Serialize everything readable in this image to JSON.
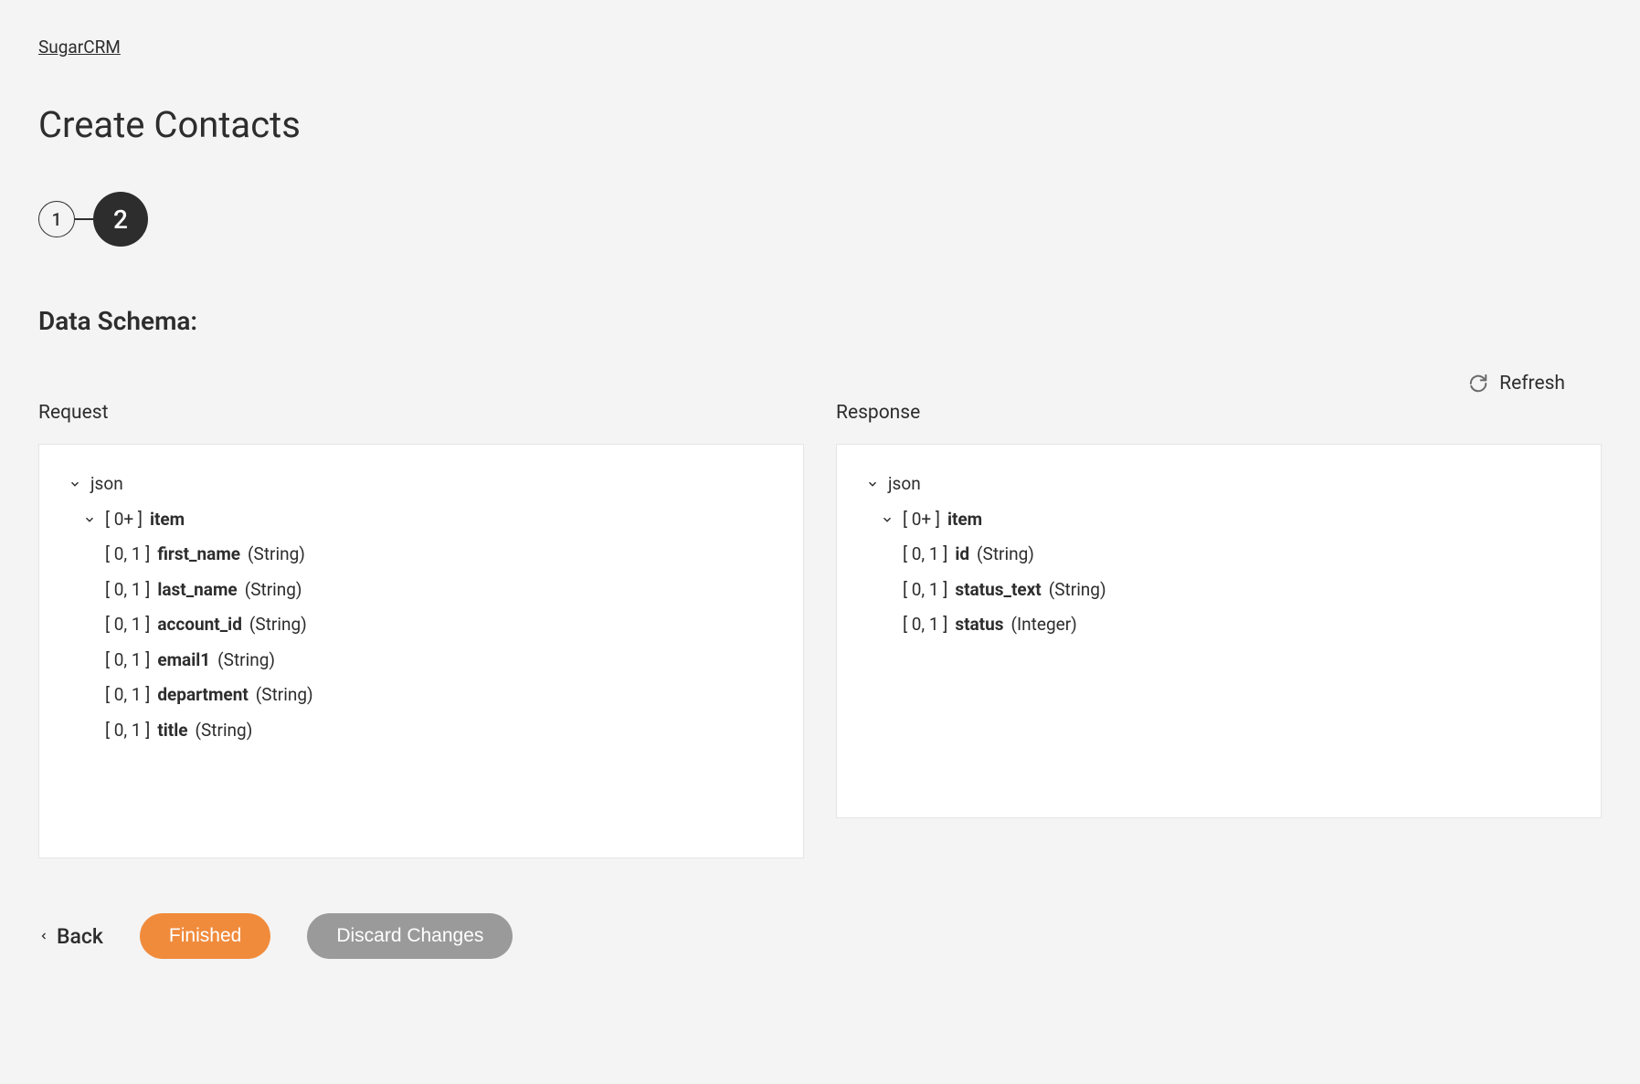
{
  "breadcrumb": "SugarCRM",
  "page_title": "Create Contacts",
  "stepper": {
    "steps": [
      "1",
      "2"
    ],
    "active_index": 1
  },
  "section_title": "Data Schema:",
  "refresh_label": "Refresh",
  "request": {
    "title": "Request",
    "root": "json",
    "item_prefix": "[ 0+ ]",
    "item_label": "item",
    "fields": [
      {
        "prefix": "[ 0, 1 ]",
        "name": "first_name",
        "type": "(String)"
      },
      {
        "prefix": "[ 0, 1 ]",
        "name": "last_name",
        "type": "(String)"
      },
      {
        "prefix": "[ 0, 1 ]",
        "name": "account_id",
        "type": "(String)"
      },
      {
        "prefix": "[ 0, 1 ]",
        "name": "email1",
        "type": "(String)"
      },
      {
        "prefix": "[ 0, 1 ]",
        "name": "department",
        "type": "(String)"
      },
      {
        "prefix": "[ 0, 1 ]",
        "name": "title",
        "type": "(String)"
      }
    ]
  },
  "response": {
    "title": "Response",
    "root": "json",
    "item_prefix": "[ 0+ ]",
    "item_label": "item",
    "fields": [
      {
        "prefix": "[ 0, 1 ]",
        "name": "id",
        "type": "(String)"
      },
      {
        "prefix": "[ 0, 1 ]",
        "name": "status_text",
        "type": "(String)"
      },
      {
        "prefix": "[ 0, 1 ]",
        "name": "status",
        "type": "(Integer)"
      }
    ]
  },
  "footer": {
    "back": "Back",
    "finished": "Finished",
    "discard": "Discard Changes"
  }
}
